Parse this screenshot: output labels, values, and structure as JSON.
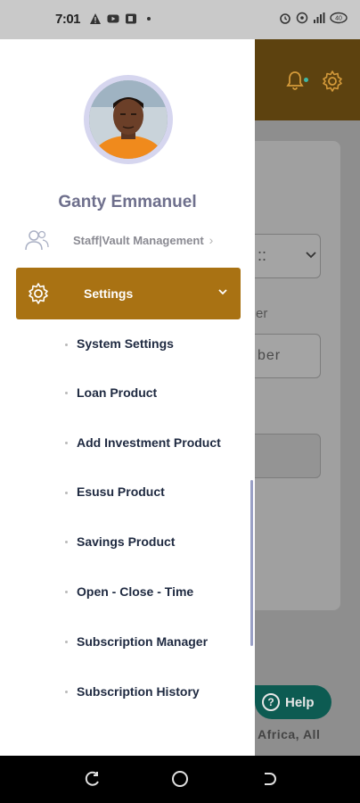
{
  "status_bar": {
    "time": "7:01",
    "left_icons": [
      "warning-icon",
      "youtube-icon",
      "office-icon",
      "dot-icon"
    ],
    "right_icons": [
      "alarm-icon",
      "hotspot-icon",
      "signal-icon",
      "battery-icon"
    ],
    "battery": "40"
  },
  "profile": {
    "name": "Ganty Emmanuel"
  },
  "menu": {
    "staff_label": "Staff|Vault Management",
    "settings_label": "Settings",
    "sub_items": [
      "System Settings",
      "Loan Product",
      "Add Investment Product",
      "Esusu Product",
      "Savings Product",
      "Open - Close - Time",
      "Subscription Manager",
      "Subscription History"
    ]
  },
  "background": {
    "select_text": "::",
    "label_text": "er",
    "input_text": "ber",
    "help_label": "Help",
    "footer_text": "Africa, All"
  },
  "colors": {
    "accent": "#a97213",
    "header_bg": "#5d420f",
    "help_bg": "#0d5b52",
    "name_color": "#6e6f8c"
  }
}
